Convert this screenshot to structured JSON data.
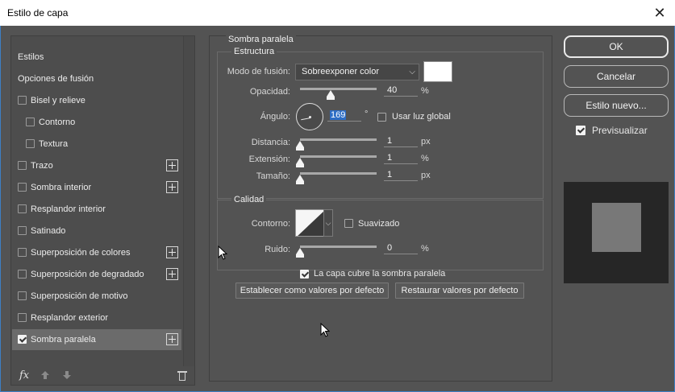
{
  "window": {
    "title": "Estilo de capa",
    "close_glyph": "✕"
  },
  "sidebar": {
    "header_items": [
      {
        "label": "Estilos"
      },
      {
        "label": "Opciones de fusión"
      }
    ],
    "items": [
      {
        "label": "Bisel y relieve",
        "checked": false,
        "plus": false,
        "indent": false
      },
      {
        "label": "Contorno",
        "checked": false,
        "plus": false,
        "indent": true
      },
      {
        "label": "Textura",
        "checked": false,
        "plus": false,
        "indent": true
      },
      {
        "label": "Trazo",
        "checked": false,
        "plus": true,
        "indent": false
      },
      {
        "label": "Sombra interior",
        "checked": false,
        "plus": true,
        "indent": false
      },
      {
        "label": "Resplandor interior",
        "checked": false,
        "plus": false,
        "indent": false
      },
      {
        "label": "Satinado",
        "checked": false,
        "plus": false,
        "indent": false
      },
      {
        "label": "Superposición de colores",
        "checked": false,
        "plus": true,
        "indent": false
      },
      {
        "label": "Superposición de degradado",
        "checked": false,
        "plus": true,
        "indent": false
      },
      {
        "label": "Superposición de motivo",
        "checked": false,
        "plus": false,
        "indent": false
      },
      {
        "label": "Resplandor exterior",
        "checked": false,
        "plus": false,
        "indent": false
      },
      {
        "label": "Sombra paralela",
        "checked": true,
        "plus": true,
        "indent": false,
        "selected": true
      }
    ],
    "footer": {
      "fx_label": "fx",
      "up_icon": "arrow-up-icon",
      "down_icon": "arrow-down-icon",
      "trash_icon": "trash-icon"
    }
  },
  "drop_shadow": {
    "section_title": "Sombra paralela",
    "structure": {
      "title": "Estructura",
      "blend_mode_label": "Modo de fusión:",
      "blend_mode_value": "Sobreexponer color",
      "shadow_color": "#ffffff",
      "opacity_label": "Opacidad:",
      "opacity_value": "40",
      "opacity_unit": "%",
      "opacity_fraction": 0.4,
      "angle_label": "Ángulo:",
      "angle_value": "169",
      "angle_unit": "°",
      "global_light_label": "Usar luz global",
      "global_light_checked": false,
      "distance_label": "Distancia:",
      "distance_value": "1",
      "distance_unit": "px",
      "spread_label": "Extensión:",
      "spread_value": "1",
      "spread_unit": "%",
      "size_label": "Tamaño:",
      "size_value": "1",
      "size_unit": "px"
    },
    "quality": {
      "title": "Calidad",
      "contour_label": "Contorno:",
      "antialias_label": "Suavizado",
      "antialias_checked": false,
      "noise_label": "Ruido:",
      "noise_value": "0",
      "noise_unit": "%"
    },
    "knocks_out_label": "La capa cubre la sombra paralela",
    "knocks_out_checked": true,
    "make_default_label": "Establecer como valores por defecto",
    "reset_default_label": "Restaurar valores por defecto"
  },
  "actions": {
    "ok_label": "OK",
    "cancel_label": "Cancelar",
    "new_style_label": "Estilo nuevo...",
    "preview_label": "Previsualizar",
    "preview_checked": true
  }
}
